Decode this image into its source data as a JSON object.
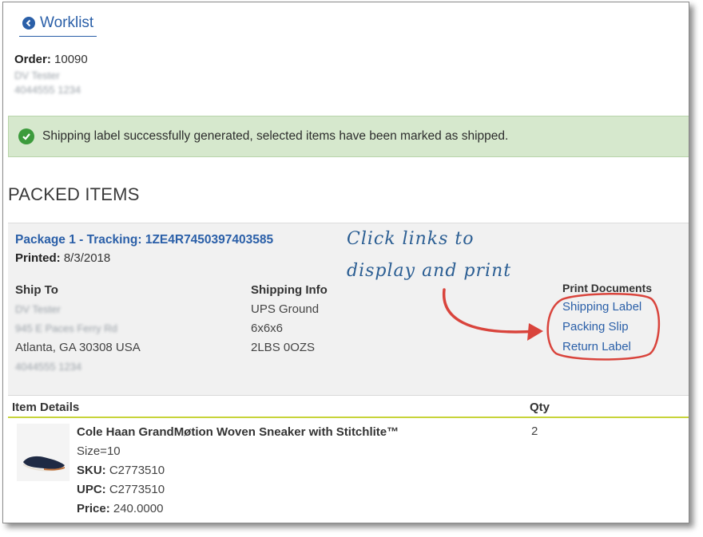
{
  "nav": {
    "back_label": "Worklist",
    "back_icon": "arrow-left-circle-icon"
  },
  "order": {
    "label": "Order:",
    "number": "10090",
    "customer_name": "DV Tester",
    "customer_phone": "4044555 1234"
  },
  "alert": {
    "message": "Shipping label successfully generated, selected items have been marked as shipped.",
    "icon": "check-circle-icon",
    "color": "#d6e8cd"
  },
  "section": {
    "title": "PACKED ITEMS"
  },
  "package": {
    "title": "Package 1 - Tracking: 1ZE4R7450397403585",
    "printed_label": "Printed:",
    "printed_date": "8/3/2018",
    "ship_to": {
      "heading": "Ship To",
      "name": "DV Tester",
      "street": "945 E Paces Ferry Rd",
      "city_line": "Atlanta, GA 30308 USA",
      "phone": "4044555 1234"
    },
    "shipping_info": {
      "heading": "Shipping Info",
      "carrier": "UPS Ground",
      "dimensions": "6x6x6",
      "weight": "2LBS 0OZS"
    },
    "print_documents": {
      "heading": "Print Documents",
      "links": [
        "Shipping Label",
        "Packing Slip",
        "Return Label"
      ]
    }
  },
  "annotation": {
    "line1": "Click links to",
    "line2": "display and print",
    "color": "#d9443c"
  },
  "items_table": {
    "headers": {
      "details": "Item Details",
      "qty": "Qty"
    },
    "items": [
      {
        "name": "Cole Haan GrandMøtion Woven Sneaker with Stitchlite™",
        "size": "Size=10",
        "sku_label": "SKU:",
        "sku": "C2773510",
        "upc_label": "UPC:",
        "upc": "C2773510",
        "price_label": "Price:",
        "price": "240.0000",
        "qty": "2"
      }
    ]
  },
  "colors": {
    "link": "#2a5fa8",
    "accent_underline": "#c7d43a",
    "success": "#3c9b3c"
  }
}
